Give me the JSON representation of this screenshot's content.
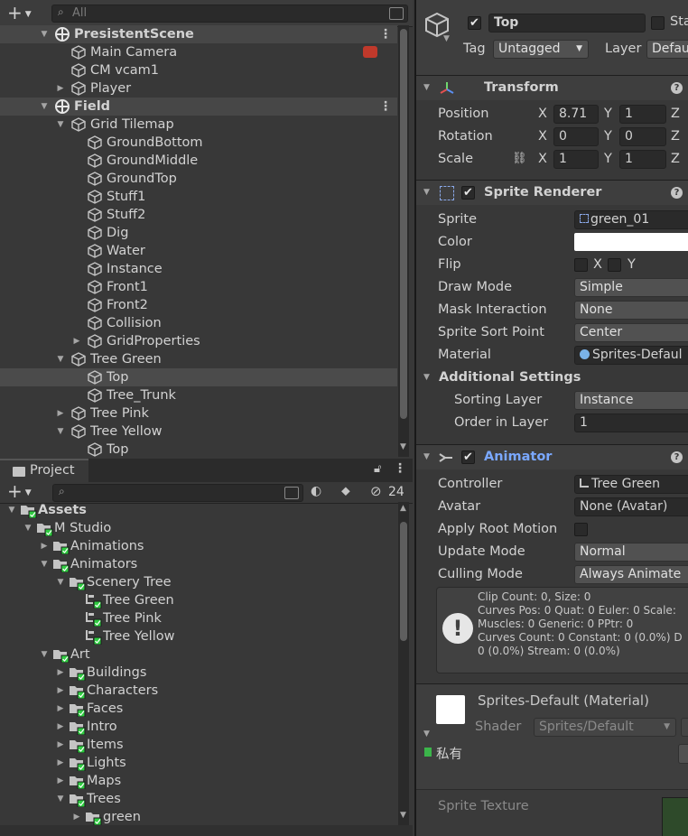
{
  "hierarchy": {
    "search_placeholder": "All",
    "rows": [
      {
        "label": "PresistentScene",
        "indent": 0,
        "type": "scene",
        "arrow": "down"
      },
      {
        "label": "Main Camera",
        "indent": 1,
        "type": "go",
        "arrow": ""
      },
      {
        "label": "CM vcam1",
        "indent": 1,
        "type": "go",
        "arrow": ""
      },
      {
        "label": "Player",
        "indent": 1,
        "type": "go",
        "arrow": "right"
      },
      {
        "label": "Field",
        "indent": 0,
        "type": "scene",
        "arrow": "down"
      },
      {
        "label": "Grid Tilemap",
        "indent": 1,
        "type": "go",
        "arrow": "down"
      },
      {
        "label": "GroundBottom",
        "indent": 2,
        "type": "go",
        "arrow": ""
      },
      {
        "label": "GroundMiddle",
        "indent": 2,
        "type": "go",
        "arrow": ""
      },
      {
        "label": "GroundTop",
        "indent": 2,
        "type": "go",
        "arrow": ""
      },
      {
        "label": "Stuff1",
        "indent": 2,
        "type": "go",
        "arrow": ""
      },
      {
        "label": "Stuff2",
        "indent": 2,
        "type": "go",
        "arrow": ""
      },
      {
        "label": "Dig",
        "indent": 2,
        "type": "go",
        "arrow": ""
      },
      {
        "label": "Water",
        "indent": 2,
        "type": "go",
        "arrow": ""
      },
      {
        "label": "Instance",
        "indent": 2,
        "type": "go",
        "arrow": ""
      },
      {
        "label": "Front1",
        "indent": 2,
        "type": "go",
        "arrow": ""
      },
      {
        "label": "Front2",
        "indent": 2,
        "type": "go",
        "arrow": ""
      },
      {
        "label": "Collision",
        "indent": 2,
        "type": "go",
        "arrow": ""
      },
      {
        "label": "GridProperties",
        "indent": 2,
        "type": "go",
        "arrow": "right"
      },
      {
        "label": "Tree Green",
        "indent": 1,
        "type": "go",
        "arrow": "down"
      },
      {
        "label": "Top",
        "indent": 2,
        "type": "go",
        "arrow": "",
        "selected": true
      },
      {
        "label": "Tree_Trunk",
        "indent": 2,
        "type": "go",
        "arrow": ""
      },
      {
        "label": "Tree Pink",
        "indent": 1,
        "type": "go",
        "arrow": "right"
      },
      {
        "label": "Tree Yellow",
        "indent": 1,
        "type": "go",
        "arrow": "down"
      },
      {
        "label": "Top",
        "indent": 2,
        "type": "go",
        "arrow": ""
      }
    ]
  },
  "project": {
    "tab_label": "Project",
    "hidden_count": "24",
    "rows": [
      {
        "label": "Assets",
        "indent": 0,
        "arrow": "down",
        "kind": "folder",
        "bold": true
      },
      {
        "label": "M Studio",
        "indent": 1,
        "arrow": "down",
        "kind": "folder"
      },
      {
        "label": "Animations",
        "indent": 2,
        "arrow": "right",
        "kind": "folder"
      },
      {
        "label": "Animators",
        "indent": 2,
        "arrow": "down",
        "kind": "folder"
      },
      {
        "label": "Scenery Tree",
        "indent": 3,
        "arrow": "down",
        "kind": "folder"
      },
      {
        "label": "Tree Green",
        "indent": 4,
        "arrow": "",
        "kind": "controller"
      },
      {
        "label": "Tree Pink",
        "indent": 4,
        "arrow": "",
        "kind": "controller"
      },
      {
        "label": "Tree Yellow",
        "indent": 4,
        "arrow": "",
        "kind": "controller"
      },
      {
        "label": "Art",
        "indent": 2,
        "arrow": "down",
        "kind": "folder"
      },
      {
        "label": "Buildings",
        "indent": 3,
        "arrow": "right",
        "kind": "folder"
      },
      {
        "label": "Characters",
        "indent": 3,
        "arrow": "right",
        "kind": "folder"
      },
      {
        "label": "Faces",
        "indent": 3,
        "arrow": "right",
        "kind": "folder"
      },
      {
        "label": "Intro",
        "indent": 3,
        "arrow": "right",
        "kind": "folder"
      },
      {
        "label": "Items",
        "indent": 3,
        "arrow": "right",
        "kind": "folder"
      },
      {
        "label": "Lights",
        "indent": 3,
        "arrow": "right",
        "kind": "folder"
      },
      {
        "label": "Maps",
        "indent": 3,
        "arrow": "right",
        "kind": "folder"
      },
      {
        "label": "Trees",
        "indent": 3,
        "arrow": "down",
        "kind": "folder"
      },
      {
        "label": "green",
        "indent": 4,
        "arrow": "right",
        "kind": "folder"
      }
    ]
  },
  "inspector": {
    "object_name": "Top",
    "static_label": "Sta",
    "tag_label": "Tag",
    "tag_value": "Untagged",
    "layer_label": "Layer",
    "layer_value": "Defau",
    "transform": {
      "title": "Transform",
      "position_label": "Position",
      "rotation_label": "Rotation",
      "scale_label": "Scale",
      "x": "X",
      "y": "Y",
      "z": "Z",
      "pos_x": "8.71",
      "pos_y": "1",
      "rot_x": "0",
      "rot_y": "0",
      "scale_x": "1",
      "scale_y": "1"
    },
    "sprite_renderer": {
      "title": "Sprite Renderer",
      "sprite_label": "Sprite",
      "sprite_value": "green_01",
      "color_label": "Color",
      "flip_label": "Flip",
      "flip_x": "X",
      "flip_y": "Y",
      "draw_mode_label": "Draw Mode",
      "draw_mode_value": "Simple",
      "mask_label": "Mask Interaction",
      "mask_value": "None",
      "sort_point_label": "Sprite Sort Point",
      "sort_point_value": "Center",
      "material_label": "Material",
      "material_value": "Sprites-Defaul",
      "additional_label": "Additional Settings",
      "sorting_layer_label": "Sorting Layer",
      "sorting_layer_value": "Instance",
      "order_label": "Order in Layer",
      "order_value": "1"
    },
    "animator": {
      "title": "Animator",
      "controller_label": "Controller",
      "controller_value": "Tree Green",
      "avatar_label": "Avatar",
      "avatar_value": "None (Avatar)",
      "root_motion_label": "Apply Root Motion",
      "update_label": "Update Mode",
      "update_value": "Normal",
      "culling_label": "Culling Mode",
      "culling_value": "Always Animate",
      "info_lines": [
        "Clip Count: 0, Size: 0",
        "Curves Pos: 0 Quat: 0 Euler: 0 Scale:",
        "Muscles: 0 Generic: 0 PPtr: 0",
        "Curves Count: 0 Constant: 0 (0.0%) D",
        "0 (0.0%) Stream: 0 (0.0%)"
      ]
    },
    "material": {
      "title": "Sprites-Default (Material)",
      "shader_label": "Shader",
      "shader_value": "Sprites/Default",
      "private_label": "私有",
      "sprite_texture_label": "Sprite Texture"
    }
  },
  "colors": {
    "accent_animator": "#7aa8ff",
    "selection": "#4b4b4b",
    "panel": "#383838"
  }
}
